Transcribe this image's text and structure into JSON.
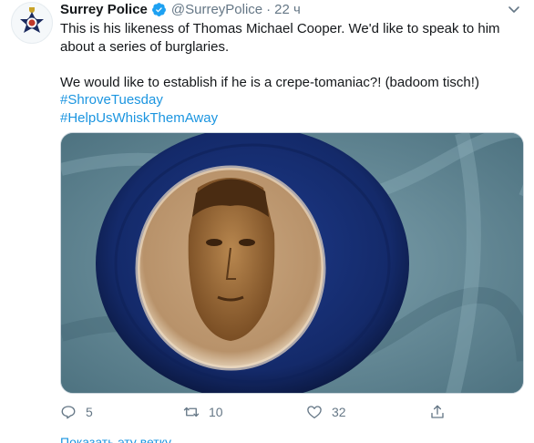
{
  "tweet": {
    "author_name": "Surrey Police",
    "handle": "@SurreyPolice",
    "separator": "·",
    "time": "22 ч",
    "verified": true,
    "avatar_icon": "police-badge-icon",
    "text_line1": "This is his likeness of Thomas Michael Cooper. We'd like to speak to him about a series of burglaries.",
    "text_line2": "We would like to establish if he is a crepe-tomaniac?! (badoom tisch!)",
    "hashtags": [
      "#ShroveTuesday",
      "#HelpUsWhiskThemAway"
    ],
    "image_icon": "pancake-portrait-image"
  },
  "actions": {
    "reply": {
      "icon": "reply-icon",
      "count": "5"
    },
    "retweet": {
      "icon": "retweet-icon",
      "count": "10"
    },
    "like": {
      "icon": "heart-icon",
      "count": "32"
    },
    "share": {
      "icon": "share-icon"
    }
  },
  "thread_link": "Показать эту ветку",
  "colors": {
    "link": "#1b95e0",
    "secondary": "#657786",
    "text": "#14171a",
    "verified": "#1da1f2",
    "badge_navy": "#1b2a5e",
    "badge_gold": "#c9a227"
  }
}
